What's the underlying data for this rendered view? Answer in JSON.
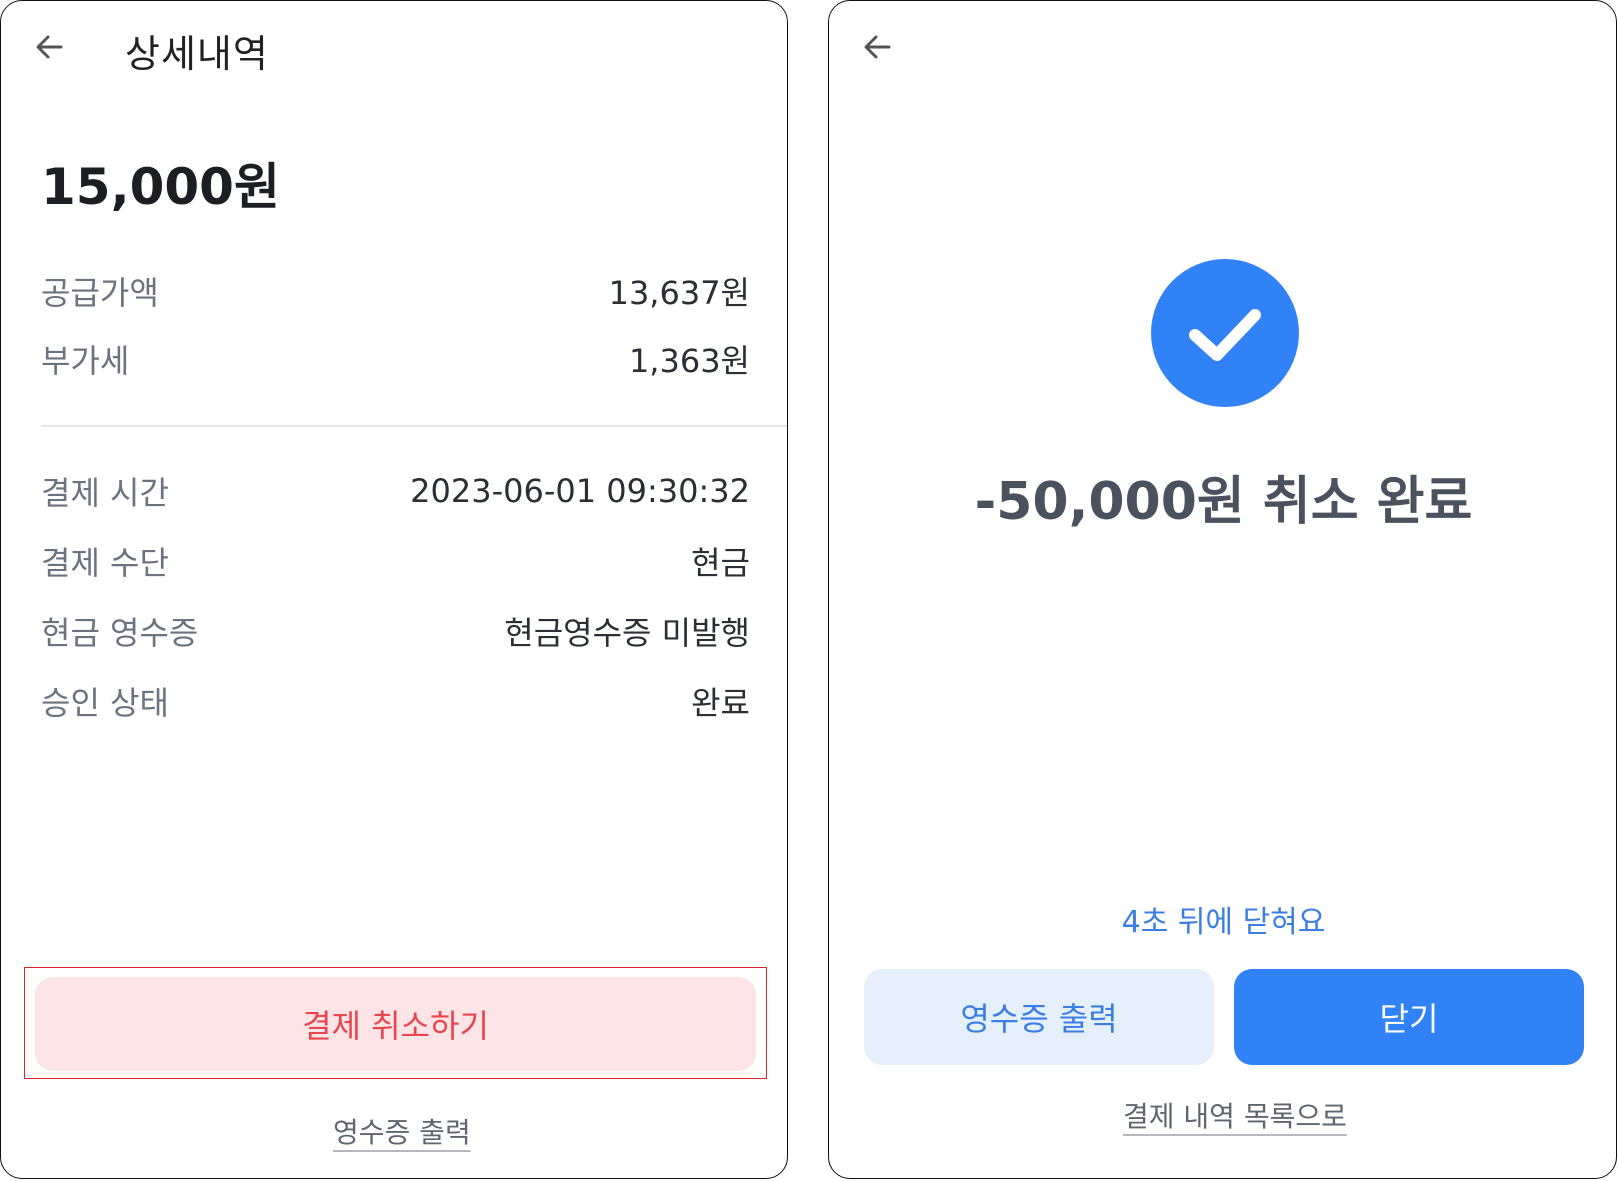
{
  "detail_screen": {
    "title": "상세내역",
    "total_amount": "15,000원",
    "summary": [
      {
        "label": "공급가액",
        "value": "13,637원"
      },
      {
        "label": "부가세",
        "value": "1,363원"
      }
    ],
    "details": [
      {
        "label": "결제 시간",
        "value": "2023-06-01 09:30:32"
      },
      {
        "label": "결제 수단",
        "value": "현금"
      },
      {
        "label": "현금 영수증",
        "value": "현금영수증 미발행"
      },
      {
        "label": "승인 상태",
        "value": "완료"
      }
    ],
    "cancel_button_label": "결제 취소하기",
    "receipt_link_label": "영수증 출력",
    "colors": {
      "cancel_bg": "#fde4e6",
      "cancel_text": "#e8454f",
      "highlight_border": "#d7262c"
    }
  },
  "complete_screen": {
    "message": "-50,000원 취소 완료",
    "countdown_text": "4초 뒤에 닫혀요",
    "receipt_button_label": "영수증 출력",
    "close_button_label": "닫기",
    "back_to_list_label": "결제 내역 목록으로",
    "status_icon": "check-circle-icon",
    "colors": {
      "accent": "#3182f6",
      "secondary_bg": "#e6f0fd"
    }
  },
  "icons": {
    "back": "arrow-left-icon"
  }
}
